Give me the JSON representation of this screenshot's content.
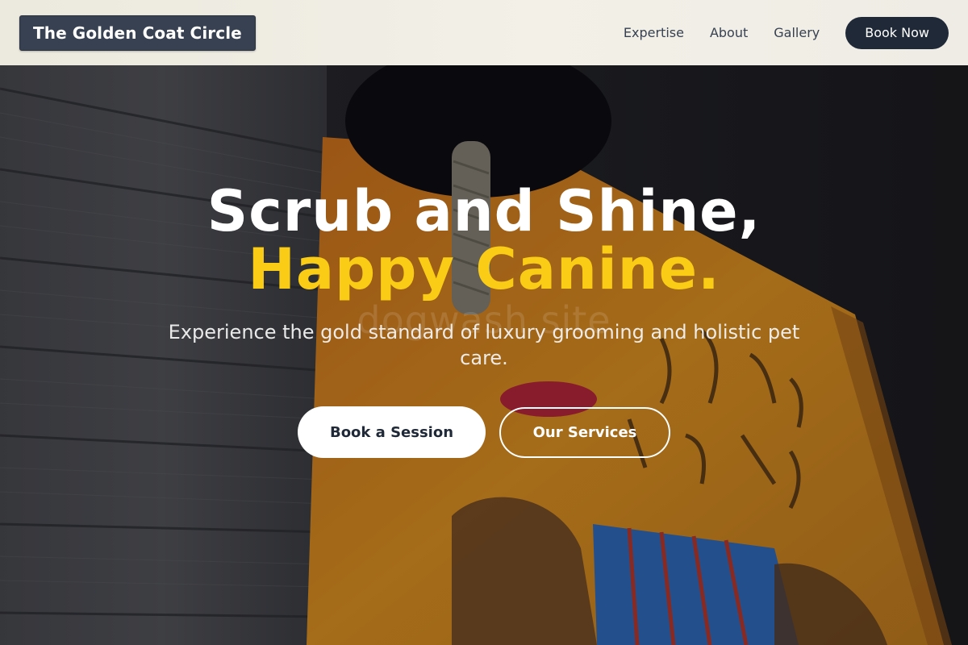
{
  "header": {
    "logo": "The Golden Coat Circle",
    "nav": [
      {
        "label": "Expertise"
      },
      {
        "label": "About"
      },
      {
        "label": "Gallery"
      }
    ],
    "cta": "Book Now"
  },
  "hero": {
    "headline_line1": "Scrub and Shine,",
    "headline_line2": "Happy Canine.",
    "subheadline": "Experience the gold standard of luxury grooming and holistic pet care.",
    "watermark": "dogwash site",
    "primary_button": "Book a Session",
    "secondary_button": "Our Services"
  },
  "colors": {
    "accent": "#facc15",
    "header_bg": "#f0eee5",
    "logo_bg": "#374151",
    "book_now_bg": "#1f2937",
    "button_text_dark": "#1f2937"
  }
}
